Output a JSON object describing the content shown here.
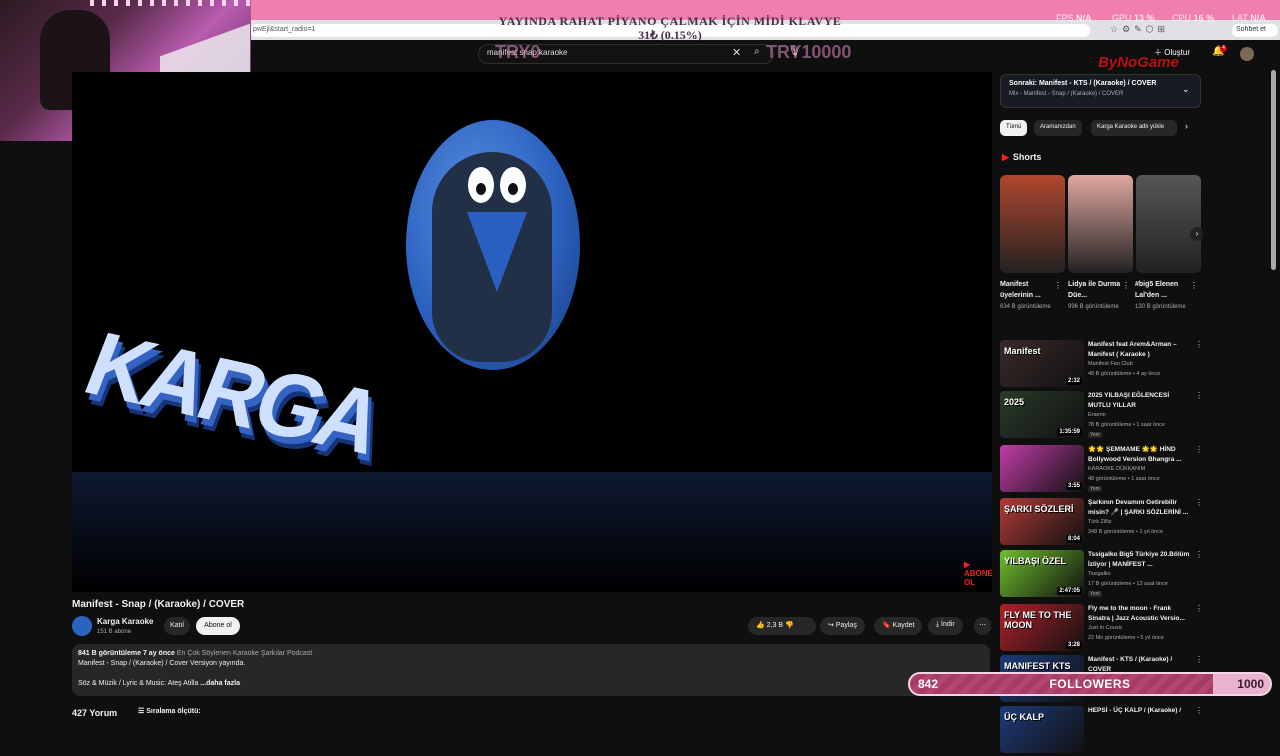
{
  "overlay": {
    "promo_line1": "YAYINDA RAHAT PİYANO ÇALMAK İÇİN MİDİ KLAVYE",
    "promo_line2": "31₺ (0.15%)",
    "stats": [
      {
        "label": "FPS",
        "value": "N/A"
      },
      {
        "label": "GPU",
        "value": "13 %"
      },
      {
        "label": "CPU",
        "value": "16 %"
      },
      {
        "label": "LAT",
        "value": "N/A"
      }
    ],
    "donation_current": "TRY0",
    "donation_goal": "TRY10000",
    "sponsor": "ByNoGame",
    "followers": {
      "current": "842",
      "label": "FOLLOWERS",
      "goal": "1000",
      "progress": 0.842
    }
  },
  "browser": {
    "url": "pwEjl&start_radio=1",
    "sohbet_label": "Sohbet et"
  },
  "header": {
    "search_value": "manifest snap karaoke",
    "create_label": "Oluştur",
    "notif_count": "4"
  },
  "player": {
    "logo_letters": "KARGA"
  },
  "video": {
    "title": "Manifest - Snap / (Karaoke) / COVER",
    "channel": "Karga Karaoke",
    "subs": "151 B abone",
    "join_label": "Katıl",
    "subscribe_label": "Abone ol",
    "likes": "2,3 B",
    "share_label": "Paylaş",
    "save_label": "Kaydet",
    "download_label": "İndir",
    "desc_views": "841 B görüntüleme",
    "desc_age": "7 ay önce",
    "desc_tags": "En Çok Söylenen Karaoke Şarkılar Podcast",
    "desc_line1": "Manifest - Snap / (Karaoke) / Cover Versiyon yayında.",
    "desc_line2": "Söz & Müzik / Lyric & Music: Ateş Atilla",
    "desc_more": "...daha fazla",
    "comments_count": "427 Yorum",
    "sort_label": "Sıralama ölçütü:"
  },
  "sidebar": {
    "next_title": "Sonraki: Manifest - KTS / (Karaoke) / COVER",
    "next_sub": "Mix - Manifest - Snap / (Karaoke) / COVER",
    "chips": [
      "Tümü",
      "Aramanızdan",
      "Karga Karaoke adlı yükle"
    ],
    "shorts_label": "Shorts",
    "shorts": [
      {
        "title": "Manifest üyelerinin ...",
        "views": "634 B görüntüleme",
        "color": "#b0472e"
      },
      {
        "title": "Lidya ile Durma Düe...",
        "views": "996 B görüntüleme",
        "color": "#e0a7a0"
      },
      {
        "title": "#big5 Elenen Lal'den ...",
        "views": "130 B görüntüleme",
        "color": "#565656"
      }
    ],
    "recommendations": [
      {
        "title": "Manifest feat Arem&Arman – Manifest ( Karaoke )",
        "channel": "Manifest Fan Club",
        "meta": "48 B görüntüleme • 4 ay önce",
        "duration": "2:32",
        "badge": "",
        "thumb_text": "Manifest",
        "color": "#3a2a2a"
      },
      {
        "title": "2025 YILBAŞI EĞLENCESİ MUTLU YILLAR",
        "channel": "Eraenn",
        "meta": "78 B görüntüleme • 1 saat önce",
        "duration": "1:35:59",
        "badge": "Yeni",
        "thumb_text": "2025",
        "color": "#2a3a2a"
      },
      {
        "title": "🌟🌟 ŞEMMAME 🌟🌟 HİND Bollywood Version Bhangra ...",
        "channel": "KARAOKE DÜKKANIM",
        "meta": "48 görüntüleme • 1 saat önce",
        "duration": "3:55",
        "badge": "Yeni",
        "thumb_text": "",
        "color": "#c23ca8"
      },
      {
        "title": "Şarkının Devamını Getirebilir misin? 🎤 | ŞARKI SÖZLERİNİ ...",
        "channel": "Türk Zilliz",
        "meta": "348 B görüntüleme • 1 yıl önce",
        "duration": "8:04",
        "badge": "",
        "thumb_text": "ŞARKI SÖZLERİ",
        "color": "#b23a3a"
      },
      {
        "title": "Tssigalko Big5 Türkiye 20.Bölüm İzliyor | MANİFEST ...",
        "channel": "Tssigalko",
        "meta": "17 B görüntüleme • 13 saat önce",
        "duration": "2:47:05",
        "badge": "Yeni",
        "thumb_text": "YILBAŞI ÖZEL",
        "color": "#6fbf2a"
      },
      {
        "title": "Fly me to the moon - Frank Sinatra | Jazz Acoustic Versio...",
        "channel": "Just In Cousic",
        "meta": "22 Mn görüntüleme • 5 yıl önce",
        "duration": "3:28",
        "badge": "",
        "thumb_text": "FLY ME TO THE MOON",
        "color": "#b0202a"
      },
      {
        "title": "Manifest - KTS / (Karaoke) / COVER",
        "channel": "",
        "meta": "",
        "duration": "",
        "badge": "",
        "thumb_text": "MANIFEST KTS",
        "color": "#1e3a7a"
      },
      {
        "title": "HEPSİ - ÜÇ KALP / (Karaoke) /",
        "channel": "",
        "meta": "",
        "duration": "",
        "badge": "",
        "thumb_text": "ÜÇ KALP",
        "color": "#1e3a7a"
      }
    ]
  }
}
